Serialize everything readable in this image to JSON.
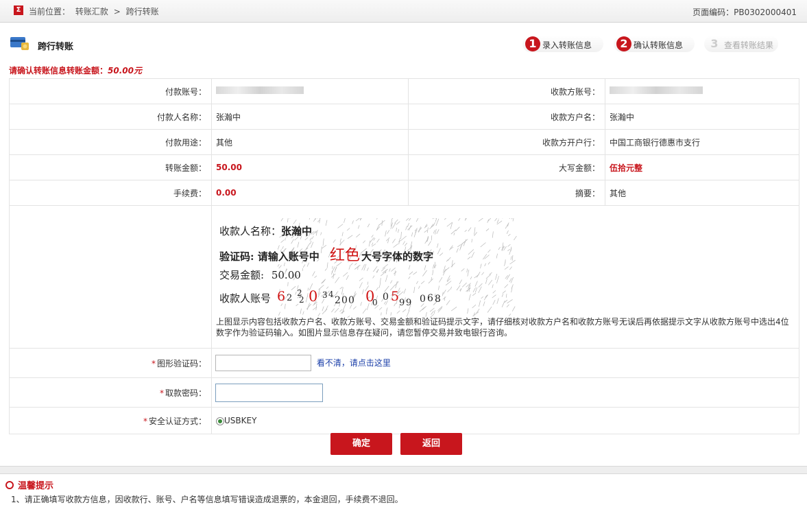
{
  "header": {
    "logo_text": "Σ",
    "crumb_label": "当前位置：",
    "crumb_1": "转账汇款",
    "crumb_sep": ">",
    "crumb_2": "跨行转账",
    "page_code": "页面编码：PB0302000401"
  },
  "title": "跨行转账",
  "steps": [
    {
      "num": "1",
      "label": "录入转账信息",
      "active": true
    },
    {
      "num": "2",
      "label": "确认转账信息",
      "active": true
    },
    {
      "num": "3",
      "label": "查看转账结果",
      "active": false
    }
  ],
  "notice": {
    "prefix": "请确认转账信息转账金额：",
    "amount": "50.00元"
  },
  "rows": [
    {
      "l1": "付款账号：",
      "v1": "",
      "l2": "收款方账号：",
      "v2": ""
    },
    {
      "l1": "付款人名称：",
      "v1": "张瀚中",
      "l2": "收款方户名：",
      "v2": "张瀚中"
    },
    {
      "l1": "付款用途：",
      "v1": "其他",
      "l2": "收款方开户行：",
      "v2": "中国工商银行德惠市支行"
    },
    {
      "l1": "转账金额：",
      "v1": "50.00",
      "l2": "大写金额：",
      "v2": "伍拾元整"
    },
    {
      "l1": "手续费：",
      "v1": "0.00",
      "l2": "摘要：",
      "v2": "其他"
    }
  ],
  "captcha": {
    "line1_label": "收款人名称：",
    "line1_value": "张瀚中",
    "line2_label": "验证码: 请输入账号中",
    "line2_red": "红色",
    "line2_tail": "大号字体的数字",
    "line3_label": "交易金额:",
    "line3_value": "50.00",
    "line4_label": "收款人账号"
  },
  "tip": "上图显示内容包括收款方户名、收款方账号、交易金额和验证码提示文字，请仔细核对收款方户名和收款方账号无误后再依据提示文字从收款方账号中选出4位数字作为验证码输入。如图片显示信息存在疑问，请您暂停交易并致电银行咨询。",
  "form": {
    "captcha_label": "图形验证码：",
    "captcha_link": "看不清，请点击这里",
    "password_label": "取款密码：",
    "auth_label": "安全认证方式：",
    "auth_option": "USBKEY",
    "required_mark": "*"
  },
  "buttons": {
    "confirm": "确定",
    "back": "返回"
  },
  "warm": {
    "title": "温馨提示",
    "text": "1、请正确填写收款方信息，因收款行、账号、户名等信息填写错误造成退票的，本金退回，手续费不退回。"
  }
}
